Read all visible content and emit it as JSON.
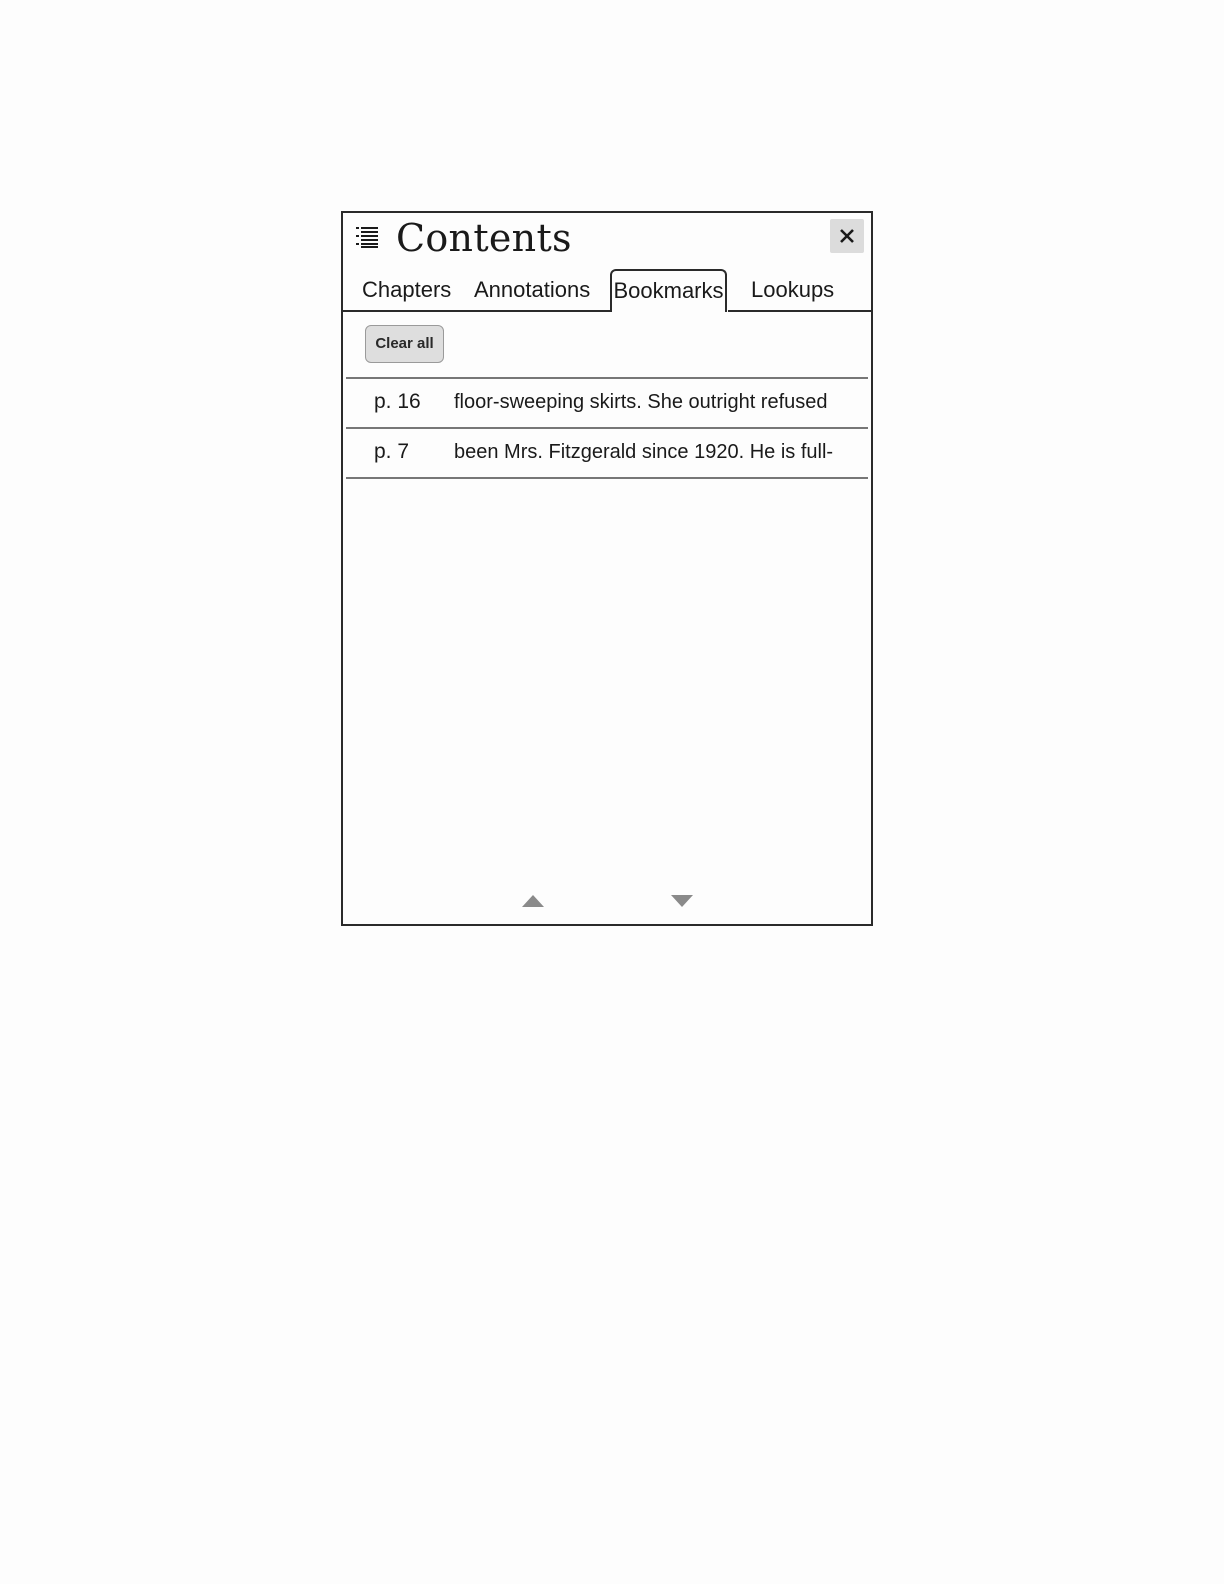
{
  "header": {
    "title": "Contents",
    "menu_icon": "list-icon",
    "close_icon": "close-icon"
  },
  "tabs": [
    {
      "label": "Chapters",
      "active": false
    },
    {
      "label": "Annotations",
      "active": false
    },
    {
      "label": "Bookmarks",
      "active": true
    },
    {
      "label": "Lookups",
      "active": false
    }
  ],
  "actions": {
    "clear_all_label": "Clear all"
  },
  "bookmarks": [
    {
      "page": "p. 16",
      "snippet": "floor-sweeping skirts. She outright refused"
    },
    {
      "page": "p. 7",
      "snippet": "been Mrs. Fitzgerald since 1920. He is full-"
    }
  ],
  "pager": {
    "up_icon": "triangle-up-icon",
    "down_icon": "triangle-down-icon"
  },
  "colors": {
    "border": "#2a2a2a",
    "button_bg": "#dedede",
    "arrow": "#8a8a8a"
  }
}
